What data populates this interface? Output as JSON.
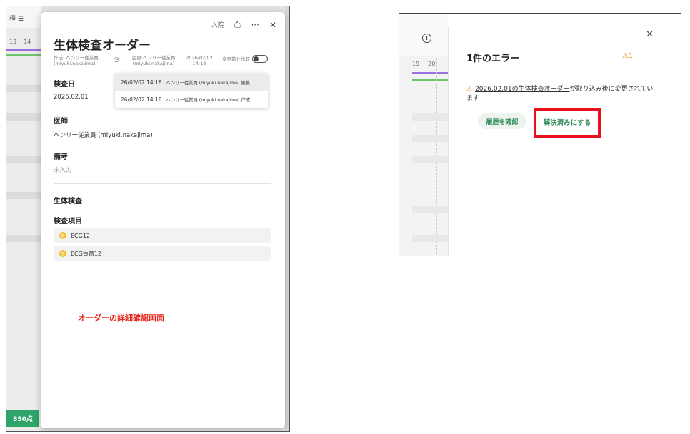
{
  "left": {
    "bg": {
      "toolbar_text": "程 ☰",
      "cols": [
        "13",
        "14"
      ],
      "score": "850点"
    },
    "modal": {
      "top_actions": {
        "admit_label": "入院",
        "print_icon": "⎙",
        "more_icon": "···",
        "close_icon": "✕"
      },
      "title": "生体検査オーダー",
      "created": "作成: ヘンリー従業員 (miyuki.nakajima)",
      "changed": "変更:ヘンリー従業員 (miyuki.nakajima)",
      "changed_date": "2026/02/02 14:18",
      "compare_label": "変更前と比較",
      "history": [
        {
          "datetime": "26/02/02 14:18",
          "who": "ヘンリー従業員 (miyuki.nakajima) 編集"
        },
        {
          "datetime": "26/02/02 14:18",
          "who": "ヘンリー従業員 (miyuki.nakajima) 作成"
        }
      ],
      "exam_date_label": "検査日",
      "exam_date_value": "2026.02.01",
      "doctor_label": "医師",
      "doctor_value": "ヘンリー従業員 (miyuki.nakajima)",
      "remarks_label": "備考",
      "remarks_value": "未入力",
      "biotest_label": "生体検査",
      "items_label": "検査項目",
      "items": [
        {
          "badge": "生",
          "name": "ECG12"
        },
        {
          "badge": "生",
          "name": "ECG負荷12"
        }
      ]
    },
    "caption": "オーダーの詳細確認画面"
  },
  "right": {
    "bg": {
      "cols": [
        "19",
        "20"
      ],
      "alert_icon": "!"
    },
    "close_icon": "✕",
    "title": "1件のエラー",
    "count": "⚠1",
    "warn_icon": "⚠",
    "message_link": "2026.02.01の生体検査オーダー",
    "message_rest": "が取り込み後に変更されています",
    "btn_history": "履歴を確認",
    "btn_resolve": "解決済みにする"
  },
  "colors": {
    "accent_green": "#2d8a57",
    "warning": "#e89b18",
    "highlight_red": "#e8101a",
    "caption_red": "#e8241a"
  }
}
